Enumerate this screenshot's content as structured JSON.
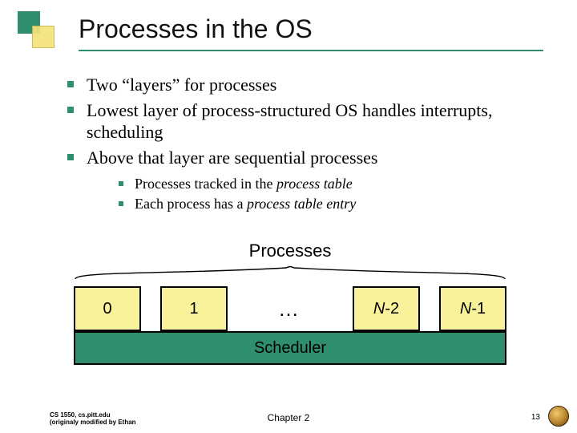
{
  "title": "Processes in the OS",
  "bullets": {
    "b1": "Two “layers” for processes",
    "b2": "Lowest layer of process-structured OS handles interrupts, scheduling",
    "b3": "Above that layer are sequential processes",
    "s1_pre": "Processes tracked in the ",
    "s1_it": "process table",
    "s2_pre": "Each process has a ",
    "s2_it": "process table entry"
  },
  "diagram": {
    "label": "Processes",
    "box0": "0",
    "box1": "1",
    "dots": "…",
    "boxN2_a": "N",
    "boxN2_b": "-2",
    "boxN1_a": "N",
    "boxN1_b": "-1",
    "sched": "Scheduler"
  },
  "footer": {
    "left_l1": "CS 1550, cs.pitt.edu",
    "left_l2": "(originaly modified by Ethan",
    "center": "Chapter 2",
    "page": "13"
  }
}
